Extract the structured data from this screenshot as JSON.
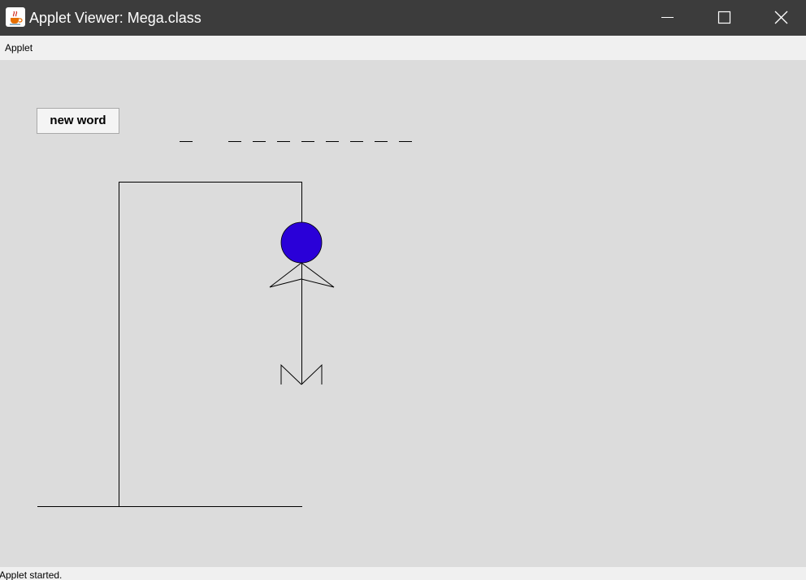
{
  "window": {
    "title": "Applet Viewer: Mega.class",
    "icon": "java-coffee-cup-icon",
    "controls": [
      "minimize-icon",
      "maximize-icon",
      "close-icon"
    ]
  },
  "menubar": {
    "items": [
      {
        "label": "Applet"
      }
    ]
  },
  "applet": {
    "new_word_label": "new word",
    "word_slots": [
      {
        "letter": ""
      },
      {
        "letter": " "
      },
      {
        "letter": ""
      },
      {
        "letter": ""
      },
      {
        "letter": ""
      },
      {
        "letter": ""
      },
      {
        "letter": ""
      },
      {
        "letter": ""
      },
      {
        "letter": ""
      },
      {
        "letter": ""
      }
    ],
    "hangman_parts": [
      "head",
      "arms",
      "body",
      "legs"
    ],
    "colors": {
      "background": "#dcdcdc",
      "head_fill": "#2a00d8",
      "lines": "#000000"
    }
  },
  "statusbar": {
    "text": "Applet started."
  }
}
